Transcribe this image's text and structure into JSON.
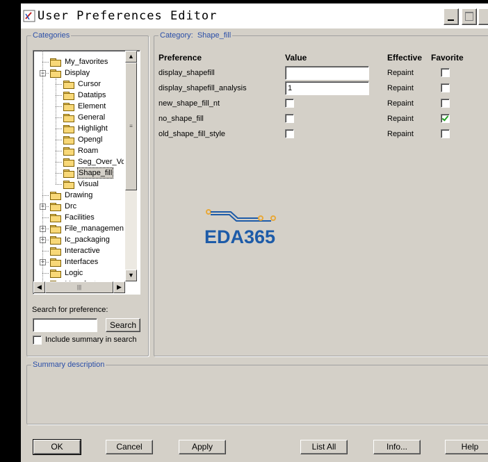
{
  "window": {
    "title": "User Preferences Editor"
  },
  "categories": {
    "legend": "Categories",
    "tree": [
      {
        "label": "My_favorites",
        "level": 0,
        "expander": ""
      },
      {
        "label": "Display",
        "level": 0,
        "expander": "−"
      },
      {
        "label": "Cursor",
        "level": 1
      },
      {
        "label": "Datatips",
        "level": 1
      },
      {
        "label": "Element",
        "level": 1
      },
      {
        "label": "General",
        "level": 1
      },
      {
        "label": "Highlight",
        "level": 1
      },
      {
        "label": "Opengl",
        "level": 1
      },
      {
        "label": "Roam",
        "level": 1
      },
      {
        "label": "Seg_Over_Vo",
        "level": 1
      },
      {
        "label": "Shape_fill",
        "level": 1,
        "selected": true
      },
      {
        "label": "Visual",
        "level": 1
      },
      {
        "label": "Drawing",
        "level": 0,
        "expander": ""
      },
      {
        "label": "Drc",
        "level": 0,
        "expander": "+"
      },
      {
        "label": "Facilities",
        "level": 0,
        "expander": ""
      },
      {
        "label": "File_management",
        "level": 0,
        "expander": "+"
      },
      {
        "label": "Ic_packaging",
        "level": 0,
        "expander": "+"
      },
      {
        "label": "Interactive",
        "level": 0,
        "expander": ""
      },
      {
        "label": "Interfaces",
        "level": 0,
        "expander": "+"
      },
      {
        "label": "Logic",
        "level": 0,
        "expander": ""
      },
      {
        "label": "Manufacture",
        "level": 0,
        "expander": "+"
      }
    ],
    "search_label": "Search for preference:",
    "search_value": "",
    "search_button": "Search",
    "include_summary_label": "Include summary in search",
    "include_summary_checked": false
  },
  "detail": {
    "category_prefix": "Category:",
    "category_name": "Shape_fill",
    "columns": {
      "preference": "Preference",
      "value": "Value",
      "effective": "Effective",
      "favorite": "Favorite"
    },
    "rows": [
      {
        "name": "display_shapefill",
        "value_type": "text",
        "value": "",
        "effective": "Repaint",
        "favorite": false
      },
      {
        "name": "display_shapefill_analysis",
        "value_type": "text",
        "value": "1",
        "effective": "Repaint",
        "favorite": false
      },
      {
        "name": "new_shape_fill_nt",
        "value_type": "checkbox",
        "checked": false,
        "effective": "Repaint",
        "favorite": false
      },
      {
        "name": "no_shape_fill",
        "value_type": "checkbox",
        "checked": false,
        "effective": "Repaint",
        "favorite": true
      },
      {
        "name": "old_shape_fill_style",
        "value_type": "checkbox",
        "checked": false,
        "effective": "Repaint",
        "favorite": false
      }
    ]
  },
  "watermark": {
    "text": "EDA365",
    "color": "#1d5ba8",
    "accent": "#e8a838"
  },
  "summary": {
    "legend": "Summary description"
  },
  "buttons": {
    "ok": "OK",
    "cancel": "Cancel",
    "apply": "Apply",
    "list_all": "List All",
    "info": "Info...",
    "help": "Help"
  },
  "colors": {
    "legend": "#2a4ea8",
    "checkmark": "#21a121",
    "face": "#d4d0c8"
  }
}
